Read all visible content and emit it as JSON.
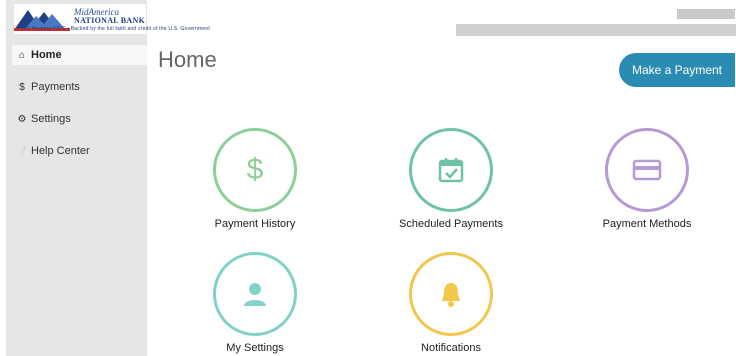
{
  "brand": {
    "name_line1": "MidAmerica",
    "name_line2": "NATIONAL BANK",
    "fdic_line": "FDIC  Member FDIC • Backed by the full faith and credit of the U.S. Government"
  },
  "sidebar": {
    "items": [
      {
        "label": "Home",
        "icon": "home-icon",
        "active": true
      },
      {
        "label": "Payments",
        "icon": "dollar-icon",
        "active": false
      },
      {
        "label": "Settings",
        "icon": "gear-icon",
        "active": false
      },
      {
        "label": "Help Center",
        "icon": "help-icon",
        "active": false
      }
    ]
  },
  "page": {
    "title": "Home",
    "primary_button": "Make a Payment"
  },
  "tiles": [
    {
      "label": "Payment History",
      "icon": "dollar-icon",
      "color": "#8ecf98"
    },
    {
      "label": "Scheduled Payments",
      "icon": "calendar-icon",
      "color": "#6fc3a4"
    },
    {
      "label": "Payment Methods",
      "icon": "credit-card-icon",
      "color": "#b69ad6"
    },
    {
      "label": "My Settings",
      "icon": "user-icon",
      "color": "#83d2c7"
    },
    {
      "label": "Notifications",
      "icon": "bell-icon",
      "color": "#f2c74a"
    }
  ],
  "colors": {
    "accent": "#2a8bb3",
    "sidebar_bg": "#e6e6e6"
  }
}
